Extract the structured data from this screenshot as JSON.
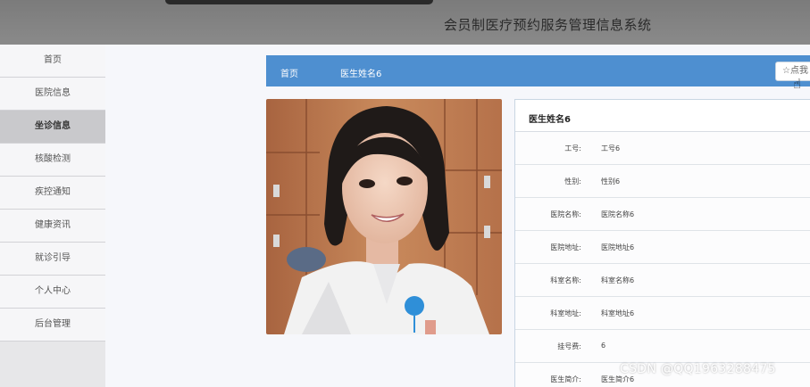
{
  "header": {
    "title": "会员制医疗预约服务管理信息系统"
  },
  "sidebar": {
    "items": [
      {
        "label": "首页"
      },
      {
        "label": "医院信息"
      },
      {
        "label": "坐诊信息"
      },
      {
        "label": "核酸检测"
      },
      {
        "label": "疾控通知"
      },
      {
        "label": "健康资讯"
      },
      {
        "label": "就诊引导"
      },
      {
        "label": "个人中心"
      },
      {
        "label": "后台管理"
      }
    ],
    "active_index": 2
  },
  "breadcrumb": {
    "home": "首页",
    "current": "医生姓名6"
  },
  "favorite_button": {
    "icon": "star-icon",
    "label": "☆点我"
  },
  "detail": {
    "title": "医生姓名6",
    "fields": [
      {
        "key": "工号:",
        "value": "工号6"
      },
      {
        "key": "性别:",
        "value": "性别6"
      },
      {
        "key": "医院名称:",
        "value": "医院名称6"
      },
      {
        "key": "医院地址:",
        "value": "医院地址6"
      },
      {
        "key": "科室名称:",
        "value": "科室名称6"
      },
      {
        "key": "科室地址:",
        "value": "科室地址6"
      },
      {
        "key": "挂号费:",
        "value": "6"
      },
      {
        "key": "医生简介:",
        "value": "医生简介6"
      }
    ]
  },
  "watermark": "CSDN @QQ1963288475",
  "colors": {
    "breadcrumb_bar": "#4e8fd0",
    "header_bg": "#808080",
    "active_nav": "#c9c9cc"
  }
}
